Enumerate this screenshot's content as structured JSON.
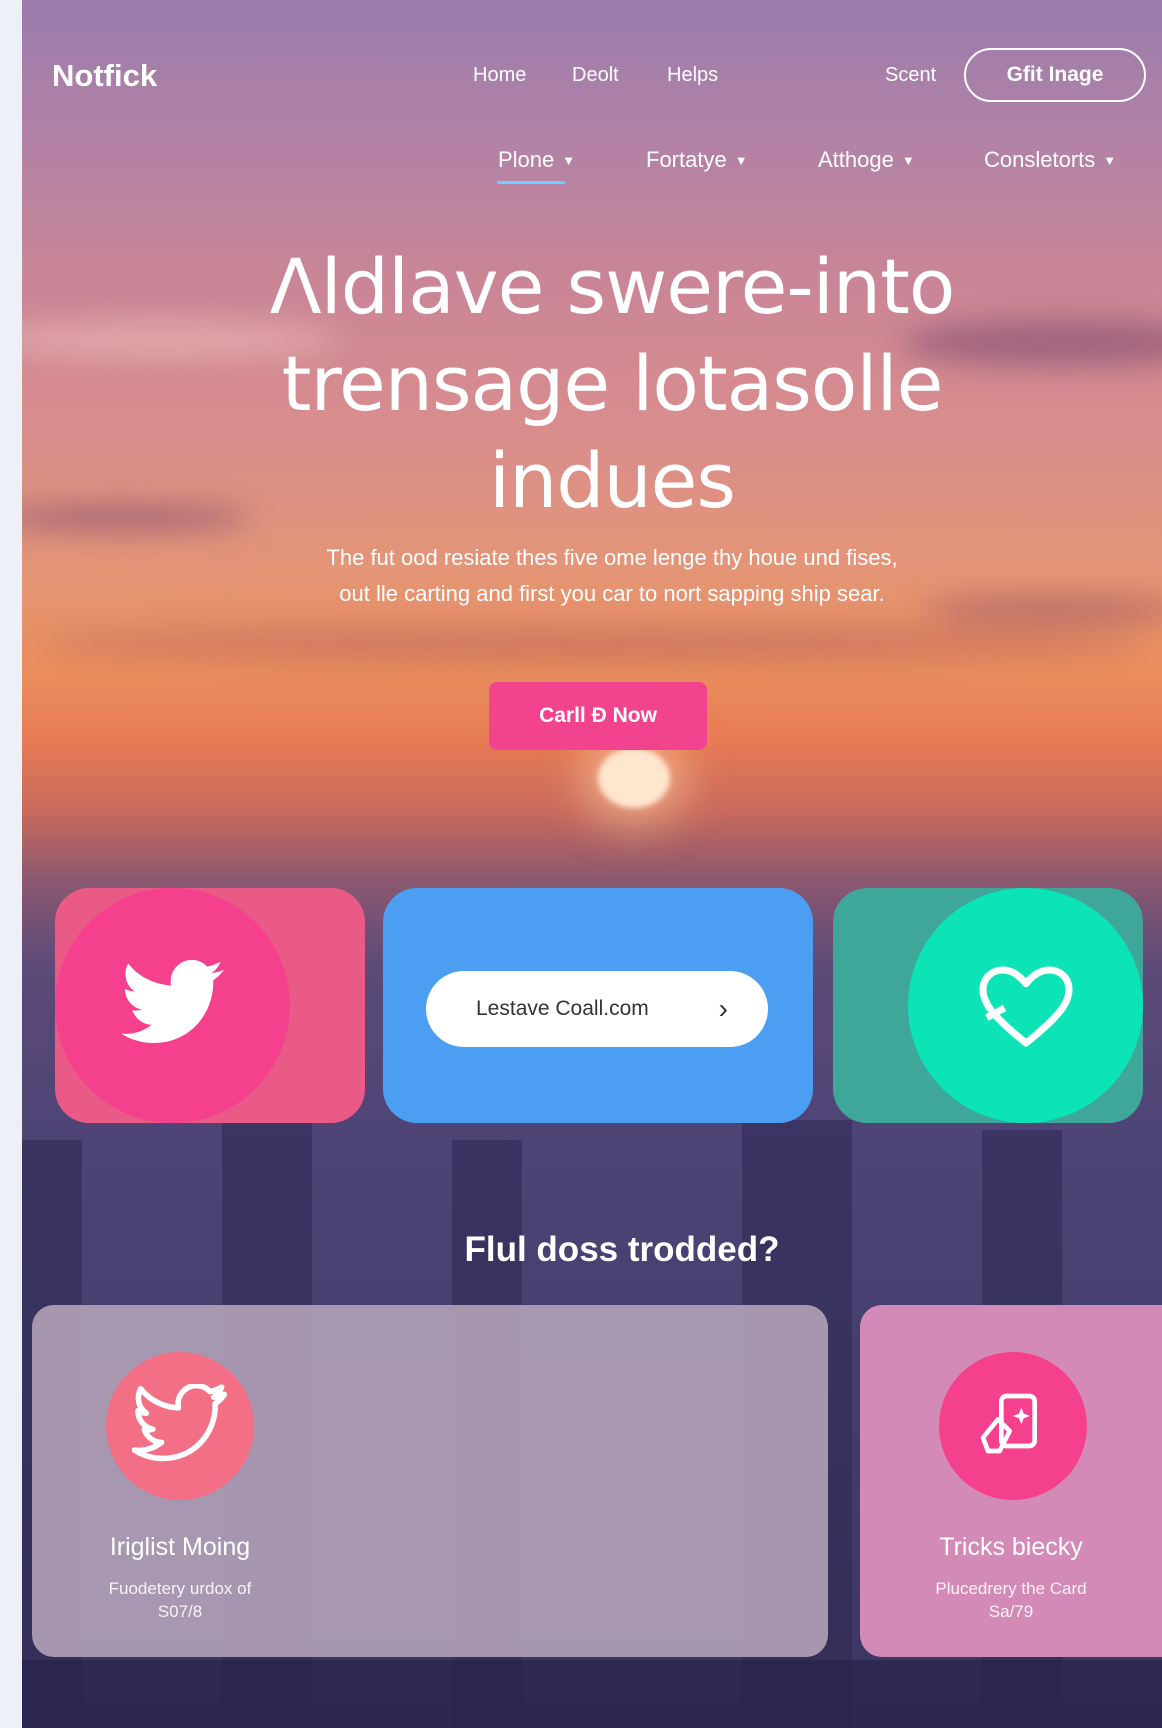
{
  "brand": {
    "name": "Notfick"
  },
  "nav": {
    "links": [
      "Home",
      "Deolt",
      "Helps"
    ],
    "secondary_link": "Scent",
    "cta": "Gfit Inage"
  },
  "subnav": {
    "items": [
      "Plone",
      "Fortatye",
      "Atthoge",
      "Consletorts"
    ],
    "active_index": 0
  },
  "hero": {
    "title_lines": [
      "Λldlave swere-into",
      "trensage lotasolle",
      "indues"
    ],
    "subtitle_lines": [
      "The fut ood resiate thes five ome lenge thy houe und fises,",
      "out lle carting and first you car to nort sapping ship sear."
    ],
    "cta": "Carll Ð Now"
  },
  "cards": {
    "left_icon": "twitter-bird-icon",
    "url_pill": {
      "text": "Lestave Coall.com",
      "arrow_icon": "chevron-right-icon"
    },
    "right_icon": "heart-outline-icon"
  },
  "section": {
    "heading": "Flul doss trodded?"
  },
  "features": [
    {
      "icon": "twitter-bird-icon",
      "title": "Iriglist Moing",
      "desc_lines": [
        "Fuodetery urdox of",
        "S07/8"
      ]
    },
    {
      "icon": "card-sparkle-icon",
      "title": "Tricks biecky",
      "desc_lines": [
        "Plucedrery the Card",
        "Sa/79"
      ]
    }
  ],
  "colors": {
    "primary_pink": "#f2448e",
    "card_blue": "#4c9ef2",
    "accent_teal": "#0ce4b8",
    "feature_right_bg": "#d48ab6"
  }
}
